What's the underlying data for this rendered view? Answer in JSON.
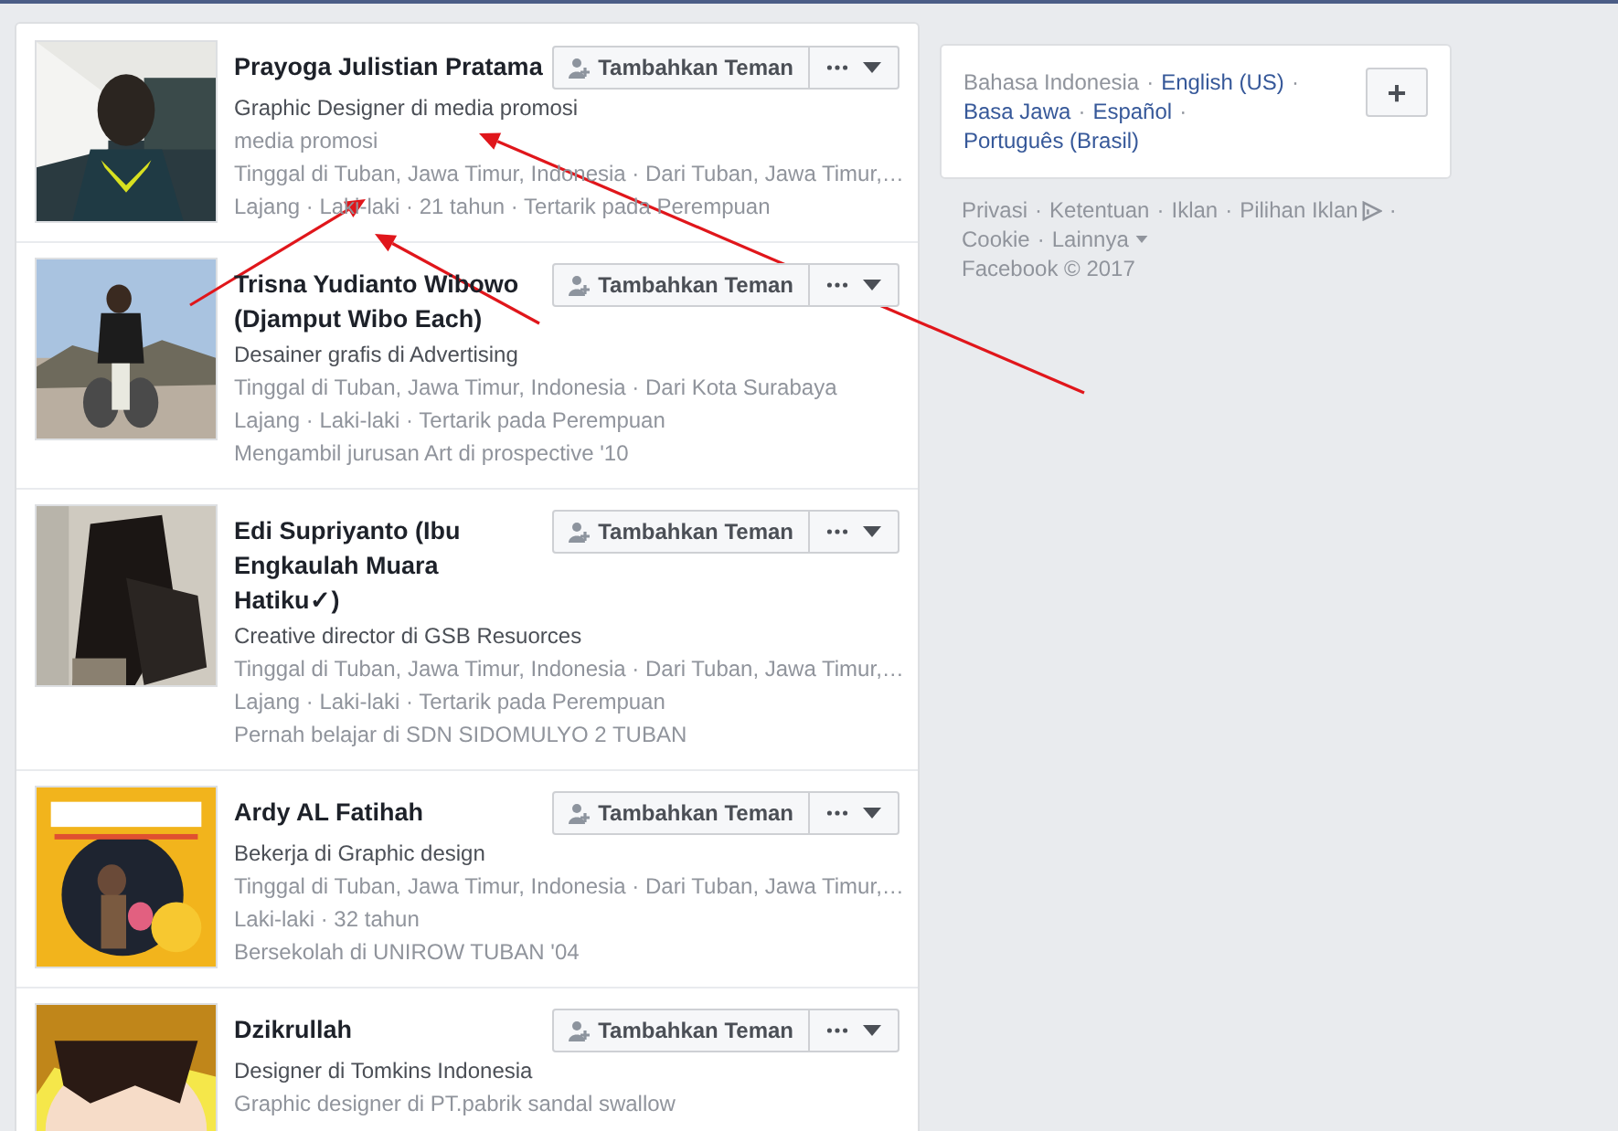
{
  "results": [
    {
      "name": "Prayoga Julistian Pratama",
      "headline": "Graphic Designer di media promosi",
      "details": [
        "media promosi",
        "Tinggal di Tuban, Jawa Timur, Indonesia · Dari Tuban, Jawa Timur,…",
        "Lajang · Laki-laki · 21 tahun · Tertarik pada Perempuan"
      ],
      "add_button": "Tambahkan Teman"
    },
    {
      "name": "Trisna Yudianto Wibowo (Djamput Wibo Each)",
      "headline": "Desainer grafis di Advertising",
      "details": [
        "Tinggal di Tuban, Jawa Timur, Indonesia · Dari Kota Surabaya",
        "Lajang · Laki-laki · Tertarik pada Perempuan",
        "Mengambil jurusan Art di prospective '10"
      ],
      "add_button": "Tambahkan Teman"
    },
    {
      "name": "Edi Supriyanto (Ibu Engkaulah Muara Hatiku✓)",
      "headline": "Creative director di GSB Resuorces",
      "details": [
        "Tinggal di Tuban, Jawa Timur, Indonesia · Dari Tuban, Jawa Timur,…",
        "Lajang · Laki-laki · Tertarik pada Perempuan",
        "Pernah belajar di SDN SIDOMULYO 2 TUBAN"
      ],
      "add_button": "Tambahkan Teman"
    },
    {
      "name": "Ardy AL Fatihah",
      "headline": "Bekerja di Graphic design",
      "details": [
        "Tinggal di Tuban, Jawa Timur, Indonesia · Dari Tuban, Jawa Timur,…",
        "Laki-laki · 32 tahun",
        "Bersekolah di UNIROW TUBAN '04"
      ],
      "add_button": "Tambahkan Teman"
    },
    {
      "name": "Dzikrullah",
      "headline": "Designer di Tomkins Indonesia",
      "details": [
        "Graphic designer di PT.pabrik sandal swallow"
      ],
      "add_button": "Tambahkan Teman"
    }
  ],
  "languages": [
    {
      "label": "Bahasa Indonesia",
      "selected": true
    },
    {
      "label": "English (US)",
      "selected": false
    },
    {
      "label": "Basa Jawa",
      "selected": false
    },
    {
      "label": "Español",
      "selected": false
    },
    {
      "label": "Português (Brasil)",
      "selected": false
    }
  ],
  "language_add_button": "+",
  "separator": "·",
  "footer_links": [
    "Privasi",
    "Ketentuan",
    "Iklan",
    "Pilihan Iklan",
    "Cookie",
    "Lainnya"
  ],
  "copyright": "Facebook © 2017"
}
